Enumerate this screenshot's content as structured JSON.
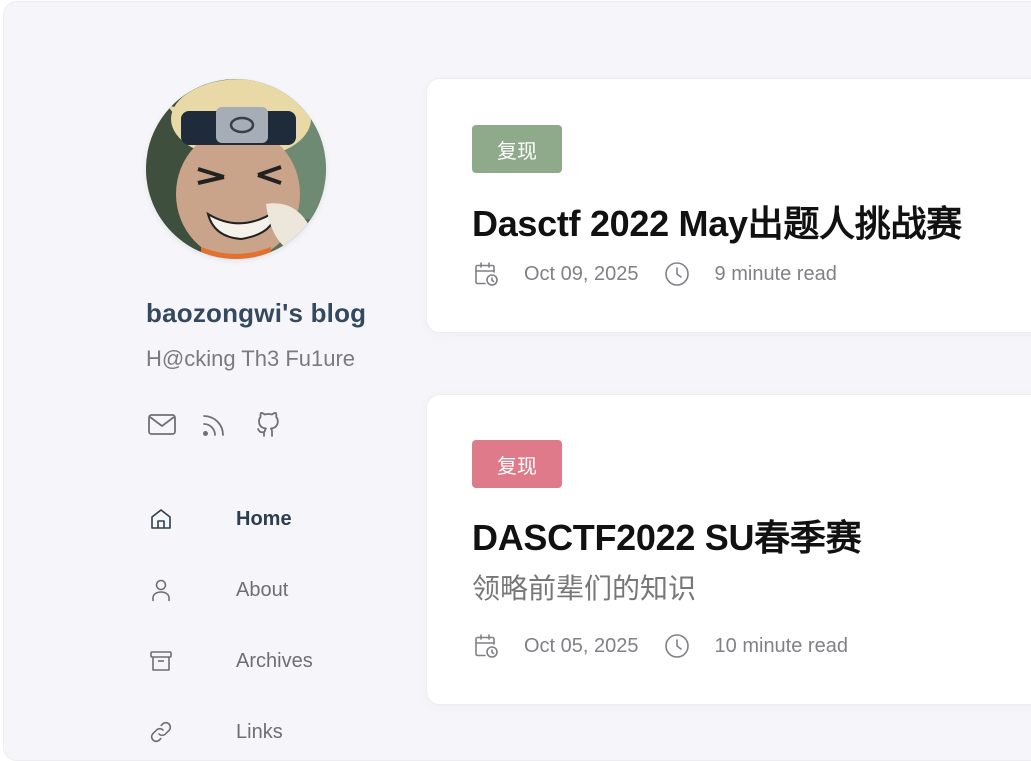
{
  "sidebar": {
    "avatar_alt": "avatar",
    "title": "baozongwi's blog",
    "subtitle": "H@cking Th3 Fu1ure",
    "social": [
      {
        "icon": "mail-icon"
      },
      {
        "icon": "rss-icon"
      },
      {
        "icon": "github-icon"
      }
    ],
    "nav": [
      {
        "label": "Home",
        "icon": "home-icon",
        "active": true
      },
      {
        "label": "About",
        "icon": "user-icon",
        "active": false
      },
      {
        "label": "Archives",
        "icon": "archive-icon",
        "active": false
      },
      {
        "label": "Links",
        "icon": "link-icon",
        "active": false
      }
    ]
  },
  "posts": [
    {
      "tag": "复现",
      "tag_color": "#8fa98b",
      "title": "Dasctf 2022 May出题人挑战赛",
      "excerpt": "",
      "date": "Oct 09, 2025",
      "read_time": "9 minute read"
    },
    {
      "tag": "复现",
      "tag_color": "#df7a8a",
      "title": "DASCTF2022 SU春季赛",
      "excerpt": "领略前辈们的知识",
      "date": "Oct 05, 2025",
      "read_time": "10 minute read"
    }
  ],
  "colors": {
    "background": "#f6f6fa",
    "card": "#ffffff",
    "title": "#34495e",
    "muted": "#7a7a80"
  }
}
